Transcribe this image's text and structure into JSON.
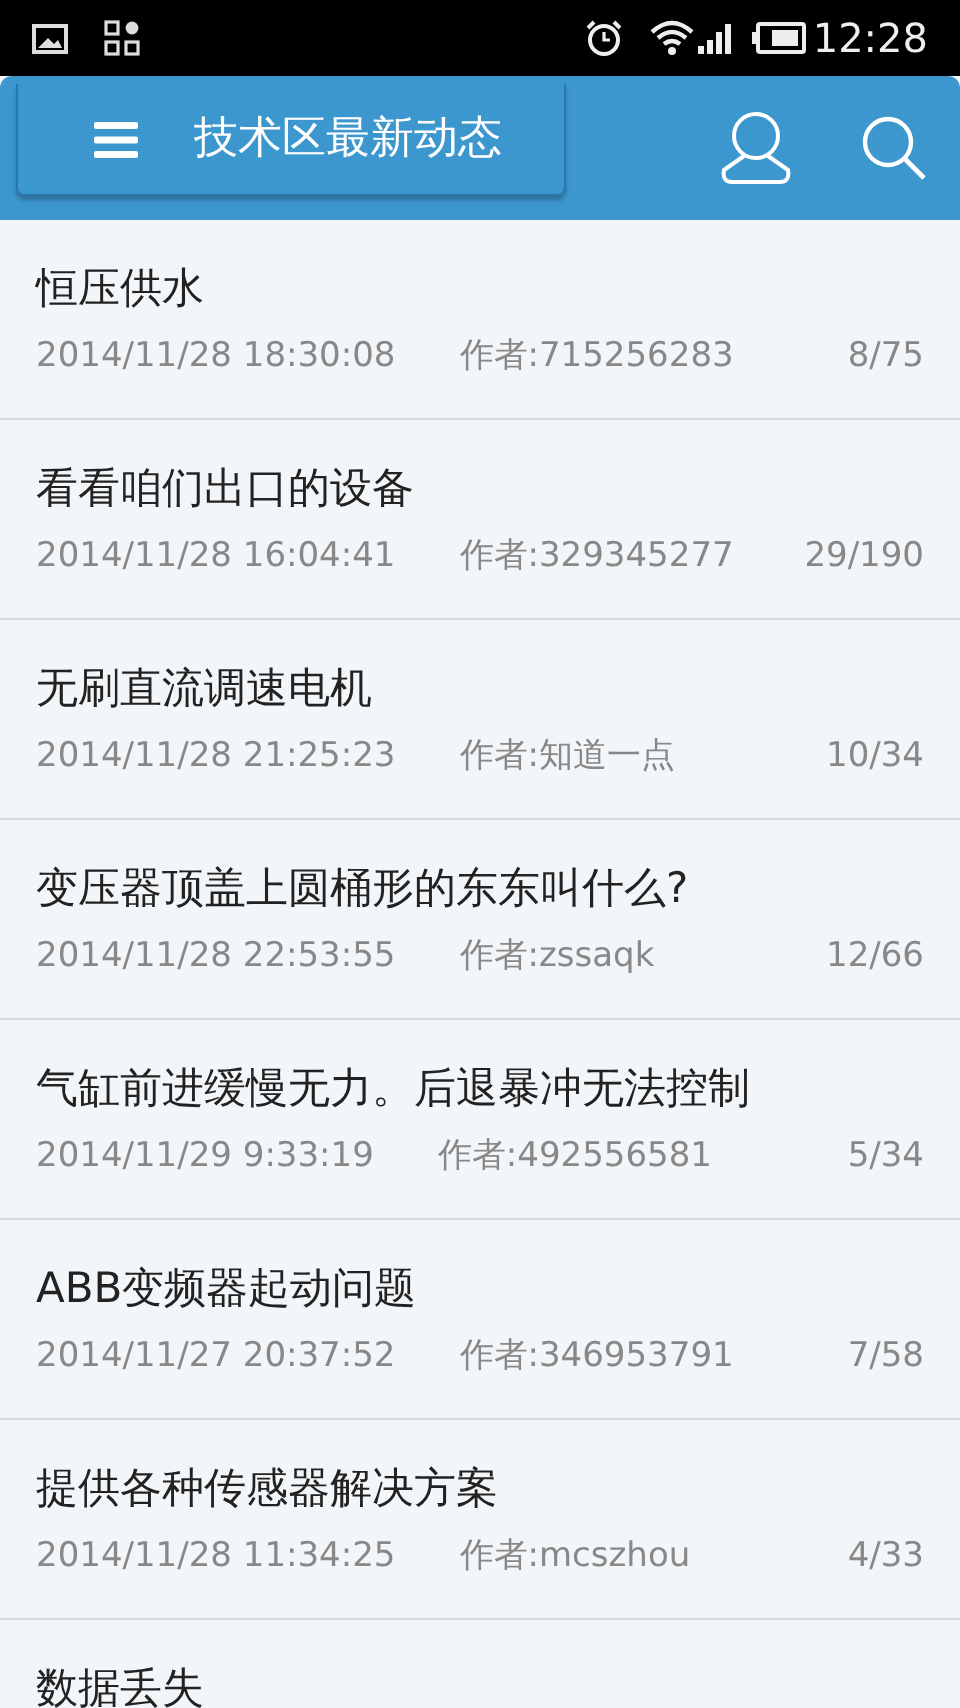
{
  "status_bar": {
    "time": "12:28"
  },
  "header": {
    "title": "技术区最新动态"
  },
  "posts": [
    {
      "title": "恒压供水",
      "date": "2014/11/28 18:30:08",
      "author": "作者:715256283",
      "count": "8/75"
    },
    {
      "title": "看看咱们出口的设备",
      "date": "2014/11/28 16:04:41",
      "author": "作者:329345277",
      "count": "29/190"
    },
    {
      "title": "无刷直流调速电机",
      "date": "2014/11/28 21:25:23",
      "author": "作者:知道一点",
      "count": "10/34"
    },
    {
      "title": "变压器顶盖上圆桶形的东东叫什么?",
      "date": "2014/11/28 22:53:55",
      "author": "作者:zssaqk",
      "count": "12/66"
    },
    {
      "title": "气缸前进缓慢无力。后退暴冲无法控制",
      "date": "2014/11/29 9:33:19",
      "author": "作者:492556581",
      "count": "5/34"
    },
    {
      "title": "ABB变频器起动问题",
      "date": "2014/11/27 20:37:52",
      "author": "作者:346953791",
      "count": "7/58"
    },
    {
      "title": "提供各种传感器解决方案",
      "date": "2014/11/28 11:34:25",
      "author": "作者:mcszhou",
      "count": "4/33"
    },
    {
      "title": "数据丢失"
    }
  ]
}
